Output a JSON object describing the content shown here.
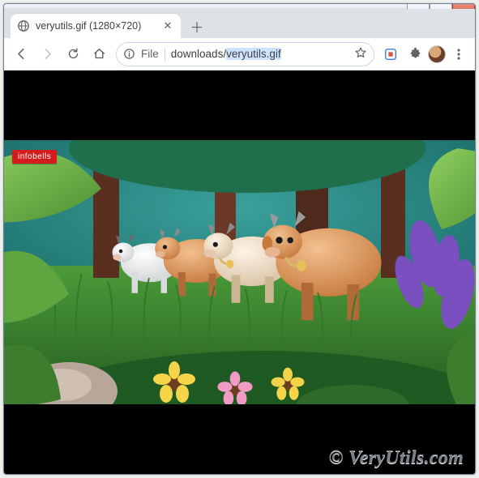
{
  "tab": {
    "title": "veryutils.gif (1280×720)",
    "favicon": "globe-icon"
  },
  "omnibox": {
    "scheme_label": "File",
    "path_prefix": "downloads/",
    "path_selected": "veryutils.gif"
  },
  "content": {
    "badge_label": "infobells"
  },
  "watermark": "© VeryUtils.com"
}
